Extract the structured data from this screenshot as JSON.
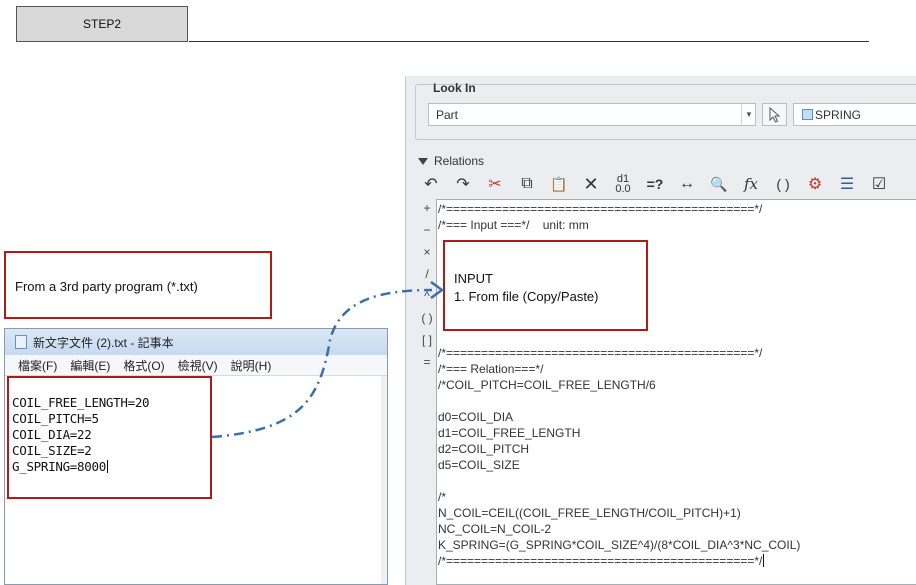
{
  "step_tab": "STEP2",
  "source_callout": "From a 3rd party program (*.txt)",
  "notepad": {
    "title": "新文字文件 (2).txt - 記事本",
    "menu": [
      "檔案(F)",
      "編輯(E)",
      "格式(O)",
      "檢視(V)",
      "說明(H)"
    ],
    "lines": [
      "COIL_FREE_LENGTH=20",
      "COIL_PITCH=5",
      "COIL_DIA=22",
      "COIL_SIZE=2",
      "G_SPRING=8000"
    ]
  },
  "dialog": {
    "look_in_label": "Look In",
    "type_value": "Part",
    "model_value": "SPRING",
    "relations_label": "Relations",
    "toolbar_icons": [
      "undo-icon",
      "redo-icon",
      "cut-icon",
      "copy-icon",
      "paste-icon",
      "delete-icon",
      "show-values-icon",
      "evaluate-icon",
      "dimension-icon",
      "verify-icon",
      "function-icon",
      "parameters-icon",
      "units-icon",
      "sort-icon",
      "execute-icon"
    ],
    "toolbar_glyphs": [
      "↶",
      "↷",
      "✂",
      "⧉",
      "📋",
      "✕",
      "d1\n0.0",
      "=?",
      "↔",
      "🔍",
      "fx",
      "( )",
      "⚙",
      "☰",
      "☑"
    ],
    "operators": [
      "+",
      "−",
      "×",
      "/",
      "^",
      "( )",
      "[ ]",
      "="
    ],
    "editor_lines": [
      "/*============================================*/",
      "/*=== Input ===*/    unit: mm",
      "",
      "",
      "",
      "",
      "",
      "",
      "",
      "/*============================================*/",
      "/*=== Relation===*/",
      "/*COIL_PITCH=COIL_FREE_LENGTH/6",
      "",
      "d0=COIL_DIA",
      "d1=COIL_FREE_LENGTH",
      "d2=COIL_PITCH",
      "d5=COIL_SIZE",
      "",
      "/*",
      "N_COIL=CEIL((COIL_FREE_LENGTH/COIL_PITCH)+1)",
      "NC_COIL=N_COIL-2",
      "K_SPRING=(G_SPRING*COIL_SIZE^4)/(8*COIL_DIA^3*NC_COIL)",
      "/*============================================*/"
    ]
  },
  "input_callout": {
    "title": "INPUT",
    "subtitle": "1. From file (Copy/Paste)"
  },
  "colors": {
    "callout_border": "#b01a1a",
    "connector": "#3a6fa8"
  }
}
